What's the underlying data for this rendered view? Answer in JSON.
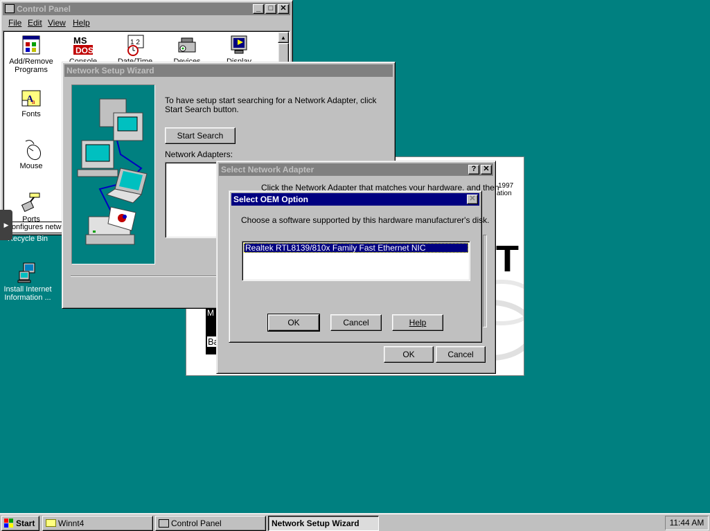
{
  "desktop": {
    "icons": [
      {
        "name": "Recycle Bin"
      },
      {
        "line1": "Install Internet",
        "line2": "Information ..."
      }
    ],
    "tooltip": "Configures netwo"
  },
  "control_panel": {
    "title": "Control Panel",
    "menu": [
      "File",
      "Edit",
      "View",
      "Help"
    ],
    "icons": [
      {
        "line1": "Add/Remove",
        "line2": "Programs"
      },
      {
        "line1": "Console"
      },
      {
        "line1": "Date/Time"
      },
      {
        "line1": "Devices"
      },
      {
        "line1": "Display"
      },
      {
        "line1": "Fonts"
      },
      {
        "line1": "Mouse"
      },
      {
        "line1": "Ports"
      }
    ]
  },
  "wizard": {
    "title": "Network Setup Wizard",
    "instruction": "To have setup start searching for a Network Adapter, click Start Search button.",
    "start_search": "Start Search",
    "adapters_label": "Network Adapters:"
  },
  "select_adapter": {
    "title": "Select Network Adapter",
    "instruction": "Click the Network Adapter that matches your hardware, and then",
    "ok": "OK",
    "cancel": "Cancel",
    "help_glyph": "?",
    "close_glyph": "✕"
  },
  "oem": {
    "title": "Select OEM Option",
    "instruction": "Choose a software supported by this hardware manufacturer's disk.",
    "options": [
      "Realtek RTL8139/810x Family Fast Ethernet NIC"
    ],
    "ok": "OK",
    "cancel": "Cancel",
    "help": "Help",
    "close_glyph": "✕"
  },
  "background_doc": {
    "year": "1997",
    "word": "ation",
    "big_letter": "T",
    "frag1": "M",
    "frag2": "Ba"
  },
  "taskbar": {
    "start": "Start",
    "buttons": [
      "Winnt4",
      "Control Panel",
      "Network Setup Wizard"
    ],
    "clock": "11:44 AM"
  },
  "colors": {
    "desktop": "#008080",
    "title_active": "#000080",
    "title_inactive": "#808080",
    "face": "#c0c0c0",
    "wizard_panel": "#008080"
  }
}
